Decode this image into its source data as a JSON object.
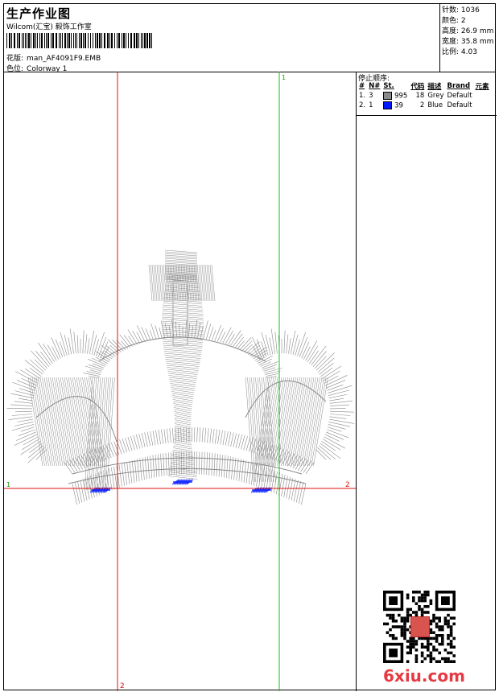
{
  "header": {
    "title": "生产作业图",
    "studio": "Wilcom(汇宝) 毅饰工作室",
    "design_label": "花版:",
    "design_value": "man_AF4091F9.EMB",
    "colorway_label": "色位:",
    "colorway_value": "Colorway 1"
  },
  "stats": [
    {
      "label": "针数:",
      "value": "1036"
    },
    {
      "label": "颜色:",
      "value": "2"
    },
    {
      "label": "高度:",
      "value": "26.9 mm"
    },
    {
      "label": "宽度:",
      "value": "35.8 mm"
    },
    {
      "label": "比例:",
      "value": "4.03"
    }
  ],
  "stop_sequence": {
    "title": "停止顺序:",
    "columns": [
      "#",
      "N#",
      "St.",
      "代码",
      "描述",
      "Brand",
      "元素"
    ],
    "rows": [
      {
        "index": "1.",
        "needle": "3",
        "swatch": "#8a8a8a",
        "stitches": "995",
        "code": "18",
        "description": "Grey",
        "brand": "Default",
        "element": ""
      },
      {
        "index": "2.",
        "needle": "1",
        "swatch": "#0019ff",
        "stitches": "39",
        "code": "2",
        "description": "Blue",
        "brand": "Default",
        "element": ""
      }
    ]
  },
  "guides": {
    "top_green": "1",
    "left_red": "1",
    "right_red": "2",
    "bottom_red": "2"
  },
  "colors": {
    "thread_grey": "#8a8a8a",
    "thread_blue": "#0019ff",
    "guide_red": "#e01010",
    "guide_green": "#10c010"
  },
  "watermark": "6xiu.com"
}
